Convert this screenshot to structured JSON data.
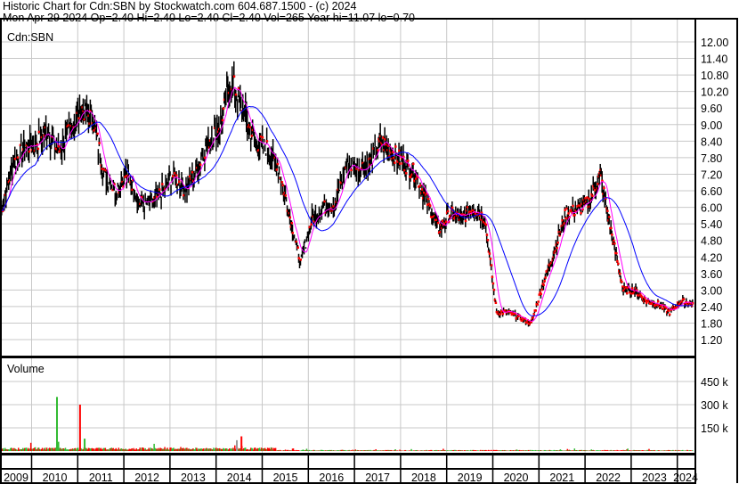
{
  "header": {
    "line1": "Historic Chart for Cdn:SBN by Stockwatch.com 604.687.1500 - (c) 2024",
    "line2": "Mon Apr 29 2024  Op=2.40  Hi=2.40  Lo=2.40  Cl=2.40  Vol=265  Year hi=11.07  lo=0.70"
  },
  "chart_data": {
    "type": "line",
    "symbol": "Cdn:SBN",
    "volume_label": "Volume",
    "price_ticks": [
      "12.00",
      "11.40",
      "10.80",
      "10.20",
      "9.60",
      "9.00",
      "8.40",
      "7.80",
      "7.20",
      "6.60",
      "6.00",
      "5.40",
      "4.80",
      "4.20",
      "3.60",
      "3.00",
      "2.40",
      "1.80",
      "1.20"
    ],
    "volume_ticks": [
      "450 k",
      "300 k",
      "150 k"
    ],
    "year_labels": [
      "2009",
      "2010",
      "2011",
      "2012",
      "2013",
      "2014",
      "2015",
      "2016",
      "2017",
      "2018",
      "2019",
      "2020",
      "2021",
      "2022",
      "2023",
      "2024"
    ],
    "ylim": [
      0.7,
      12.0
    ],
    "volume_ylim": [
      0,
      500000
    ],
    "price_series": {
      "start": 2009.33,
      "step_years": 0.25,
      "close": [
        5.8,
        7.5,
        8.2,
        8.3,
        8.8,
        8.0,
        8.8,
        9.6,
        9.2,
        7.2,
        6.6,
        7.3,
        6.2,
        6.1,
        6.6,
        7.2,
        6.6,
        7.4,
        8.4,
        9.0,
        10.6,
        9.6,
        8.4,
        8.2,
        7.6,
        5.8,
        4.0,
        5.6,
        6.0,
        6.1,
        7.6,
        7.4,
        7.6,
        8.4,
        8.0,
        7.6,
        7.2,
        6.2,
        5.2,
        5.8,
        5.6,
        6.0,
        5.6,
        2.2,
        2.2,
        2.0,
        1.8,
        3.2,
        4.4,
        5.8,
        5.9,
        6.2,
        7.2,
        5.0,
        3.0,
        3.0,
        2.6,
        2.5,
        2.2,
        2.6,
        2.5
      ]
    },
    "volume_spikes": [
      {
        "t": 2010.55,
        "v": 350000,
        "dir": "up"
      },
      {
        "t": 2010.58,
        "v": 60000,
        "dir": "up"
      },
      {
        "t": 2011.05,
        "v": 300000,
        "dir": "down"
      },
      {
        "t": 2011.15,
        "v": 80000,
        "dir": "up"
      },
      {
        "t": 2014.45,
        "v": 70000,
        "dir": "none"
      },
      {
        "t": 2014.55,
        "v": 95000,
        "dir": "down"
      }
    ],
    "series": [
      {
        "name": "price bars",
        "color": "#000000"
      },
      {
        "name": "close",
        "color": "#ff0000"
      },
      {
        "name": "short moving average",
        "color": "#ff00ff"
      },
      {
        "name": "long moving average",
        "color": "#0000ff"
      }
    ],
    "colors": {
      "up": "#33bb33",
      "down": "#ff0000",
      "grid": "#c8c8c8"
    }
  }
}
